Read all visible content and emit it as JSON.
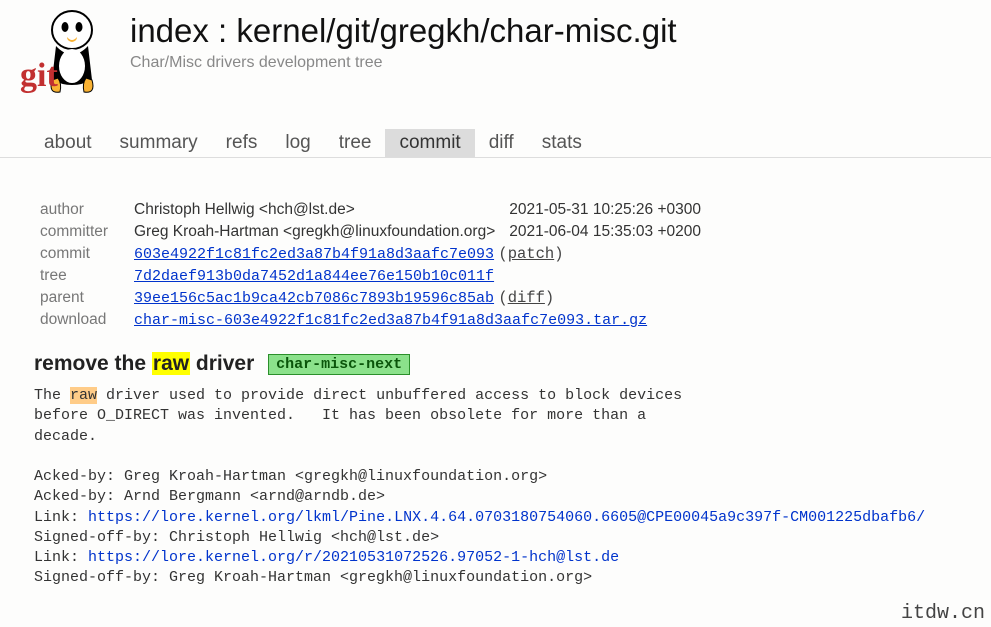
{
  "header": {
    "index_label": "index",
    "sep": " : ",
    "repo": "kernel/git/gregkh/char-misc.git",
    "subtitle": "Char/Misc drivers development tree"
  },
  "tabs": {
    "items": [
      "about",
      "summary",
      "refs",
      "log",
      "tree",
      "commit",
      "diff",
      "stats"
    ],
    "active": "commit"
  },
  "commit": {
    "labels": {
      "author": "author",
      "committer": "committer",
      "commit": "commit",
      "tree": "tree",
      "parent": "parent",
      "download": "download"
    },
    "author_name": "Christoph Hellwig <hch@lst.de>",
    "author_date": "2021-05-31 10:25:26 +0300",
    "committer_name": "Greg Kroah-Hartman <gregkh@linuxfoundation.org>",
    "committer_date": "2021-06-04 15:35:03 +0200",
    "commit_hash": "603e4922f1c81fc2ed3a87b4f91a8d3aafc7e093",
    "patch_label": "patch",
    "tree_hash": "7d2daef913b0da7452d1a844ee76e150b10c011f",
    "parent_hash": "39ee156c5ac1b9ca42cb7086c7893b19596c85ab",
    "diff_label": "diff",
    "download_file": "char-misc-603e4922f1c81fc2ed3a87b4f91a8d3aafc7e093.tar.gz"
  },
  "subject": {
    "pre": "remove the ",
    "highlight": "raw",
    "post": " driver",
    "branch": "char-misc-next"
  },
  "body": {
    "line1_pre": "The ",
    "line1_hl": "raw",
    "line1_post": " driver used to provide direct unbuffered access to block devices",
    "line2": "before O_DIRECT was invented.   It has been obsolete for more than a",
    "line3": "decade.",
    "ack1": "Acked-by: Greg Kroah-Hartman <gregkh@linuxfoundation.org>",
    "ack2": "Acked-by: Arnd Bergmann <arnd@arndb.de>",
    "link1_label": "Link: ",
    "link1": "https://lore.kernel.org/lkml/Pine.LNX.4.64.0703180754060.6605@CPE00045a9c397f-CM001225dbafb6/",
    "sign1": "Signed-off-by: Christoph Hellwig <hch@lst.de>",
    "link2_label": "Link: ",
    "link2": "https://lore.kernel.org/r/20210531072526.97052-1-hch@lst.de",
    "sign2": "Signed-off-by: Greg Kroah-Hartman <gregkh@linuxfoundation.org>"
  },
  "watermark": "itdw.cn"
}
